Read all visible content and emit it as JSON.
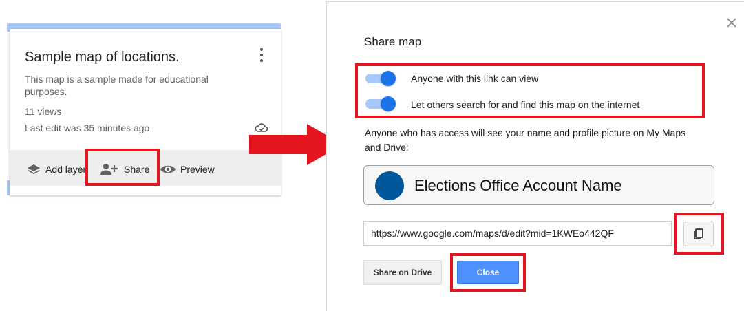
{
  "card": {
    "title": "Sample map of locations.",
    "description": "This map is a sample made for educational purposes.",
    "views": "11 views",
    "last_edit": "Last edit was 35 minutes ago",
    "footer": {
      "add_layer_label": "Add layer",
      "share_label": "Share",
      "preview_label": "Preview"
    }
  },
  "dialog": {
    "title": "Share map",
    "toggles": [
      {
        "label": "Anyone with this link can view",
        "on": true
      },
      {
        "label": "Let others search for and find this map on the internet",
        "on": true
      }
    ],
    "info": "Anyone who has access will see your name and profile picture on My Maps and Drive:",
    "account_name": "Elections Office Account Name",
    "link_value": "https://www.google.com/maps/d/edit?mid=1KWEo442QF",
    "share_drive_label": "Share on Drive",
    "close_label": "Close"
  },
  "colors": {
    "highlight": "#e4151f",
    "toggle_on": "#1a73e8",
    "close_button": "#4d90fe",
    "avatar": "#00579b"
  },
  "icons": [
    "more-vert-icon",
    "cloud-sync-icon",
    "layers-icon",
    "person-add-icon",
    "eye-icon",
    "close-icon",
    "copy-icon",
    "arrow-right-icon"
  ]
}
